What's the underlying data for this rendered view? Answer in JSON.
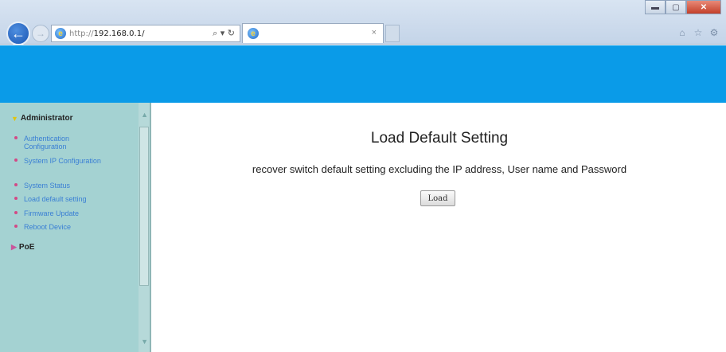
{
  "browser": {
    "url_protocol": "http://",
    "url_host": "192.168.0.1/",
    "url_controls": "⌕ ▾ ↻",
    "tab_title": "",
    "tab_close": "×",
    "window_controls": {
      "minimize": "▬",
      "maximize": "▢",
      "close": "✕"
    },
    "toolbar_icons": [
      "home-icon",
      "favorites-icon",
      "settings-icon"
    ]
  },
  "colors": {
    "banner": "#0a9be8",
    "sidebar": "#a4d2d2",
    "menu_link": "#3a7fd4",
    "bullet": "#d24a86"
  },
  "sidebar": {
    "groups": [
      {
        "title": "Administrator",
        "expanded": true,
        "items": [
          {
            "label": "Authentication Configuration"
          },
          {
            "label": "System IP Configuration"
          },
          {
            "label": "System Status"
          },
          {
            "label": "Load default setting"
          },
          {
            "label": "Firmware Update"
          },
          {
            "label": "Reboot Device"
          }
        ]
      },
      {
        "title": "PoE",
        "expanded": false,
        "items": []
      }
    ]
  },
  "main": {
    "title": "Load Default Setting",
    "description": "recover switch default setting excluding the IP address, User name and Password",
    "load_button_label": "Load"
  }
}
